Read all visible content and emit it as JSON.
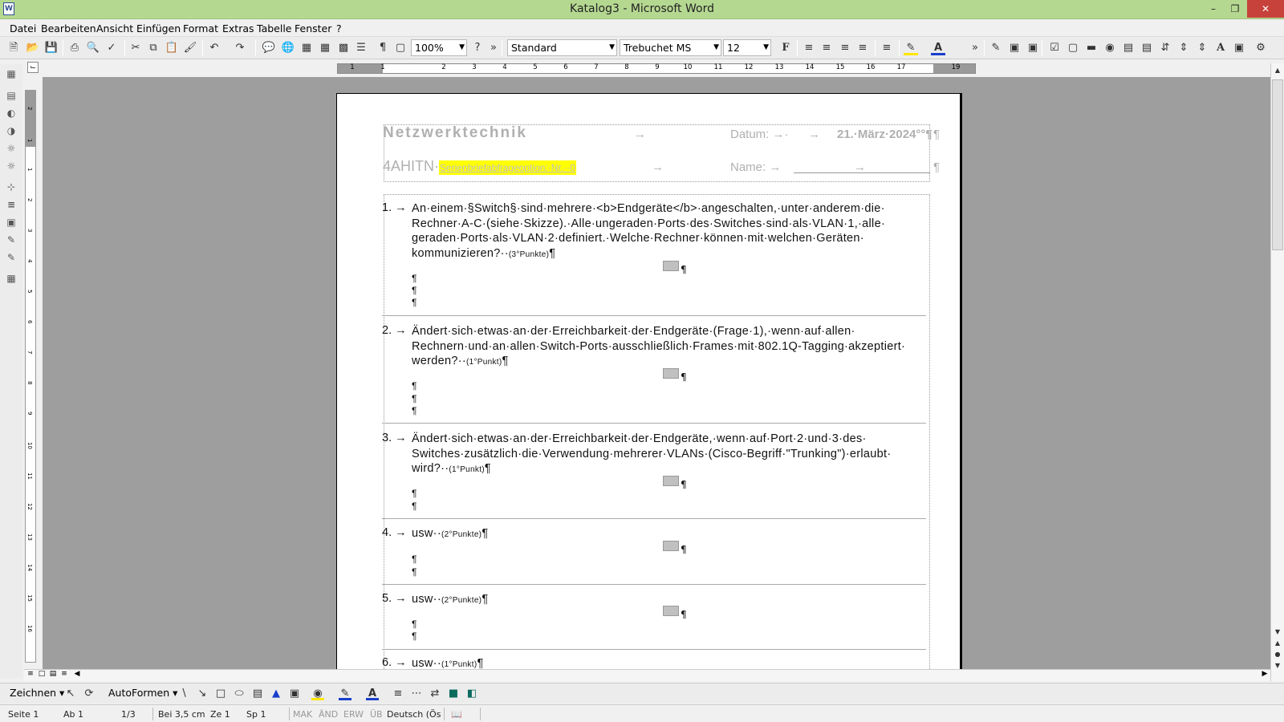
{
  "window": {
    "title": "Katalog3 - Microsoft Word",
    "app_icon": "W"
  },
  "menu": [
    "Datei",
    "Bearbeiten",
    "Ansicht",
    "Einfügen",
    "Format",
    "Extras",
    "Tabelle",
    "Fenster",
    "?"
  ],
  "toolbar": {
    "zoom": "100%",
    "style": "Standard",
    "font": "Trebuchet MS",
    "size": "12",
    "bold": "F"
  },
  "ruler_numbers": [
    "1",
    "1",
    "2",
    "3",
    "4",
    "5",
    "6",
    "7",
    "8",
    "9",
    "10",
    "11",
    "12",
    "13",
    "14",
    "15",
    "16",
    "17",
    "19"
  ],
  "vruler_numbers": [
    "2",
    "1",
    "1",
    "2",
    "3",
    "4",
    "5",
    "6",
    "7",
    "8",
    "9",
    "10",
    "11",
    "12",
    "13",
    "14",
    "15",
    "16"
  ],
  "document": {
    "header": {
      "subject": "Netzwerktechnik",
      "date_label": "Datum:",
      "date_value": "21.·März·2024°°¶",
      "class": "4AHITN·",
      "mergefield": "Serienbriefabfrageoption:·Nr.··0",
      "name_label": "Name:",
      "pil": "¶"
    },
    "questions": [
      {
        "num": "1.",
        "lines": [
          "An·einem·§Switch§·sind·mehrere·<b>Endgeräte</b>·angeschalten,·unter·anderem·die·",
          "Rechner·A-C·(siehe·Skizze).·Alle·ungeraden·Ports·des·Switches·sind·als·VLAN·1,·alle·",
          "geraden·Ports·als·VLAN·2·definiert.·Welche·Rechner·können·mit·welchen·Geräten·",
          "kommunizieren?··"
        ],
        "points": "(3°Punkte)",
        "pil": "¶"
      },
      {
        "num": "2.",
        "lines": [
          "Ändert·sich·etwas·an·der·Erreichbarkeit·der·Endgeräte·(Frage·1),·wenn·auf·allen·",
          "Rechnern·und·an·allen·Switch-Ports·ausschließlich·Frames·mit·802.1Q-Tagging·akzeptiert·",
          "werden?··"
        ],
        "points": "(1°Punkt)",
        "pil": "¶"
      },
      {
        "num": "3.",
        "lines": [
          "Ändert·sich·etwas·an·der·Erreichbarkeit·der·Endgeräte,·wenn·auf·Port·2·und·3·des·",
          "Switches·zusätzlich·die·Verwendung·mehrerer·VLANs·(Cisco-Begriff·\"Trunking\")·erlaubt·",
          "wird?··"
        ],
        "points": "(1°Punkt)",
        "pil": "¶"
      },
      {
        "num": "4.",
        "lines": [
          "usw··"
        ],
        "points": "(2°Punkte)",
        "pil": "¶"
      },
      {
        "num": "5.",
        "lines": [
          "usw··"
        ],
        "points": "(2°Punkte)",
        "pil": "¶"
      },
      {
        "num": "6.",
        "lines": [
          "usw··"
        ],
        "points": "(1°Punkt)",
        "pil": "¶"
      }
    ]
  },
  "drawbar": {
    "draw": "Zeichnen",
    "autoshapes": "AutoFormen"
  },
  "status": {
    "page": "Seite  1",
    "section": "Ab  1",
    "pages": "1/3",
    "pos": "Bei  3,5 cm",
    "line": "Ze  1",
    "col": "Sp  1",
    "mak": "MAK",
    "and": "ÄND",
    "erw": "ERW",
    "ub": "ÜB",
    "lang": "Deutsch (Ös"
  }
}
